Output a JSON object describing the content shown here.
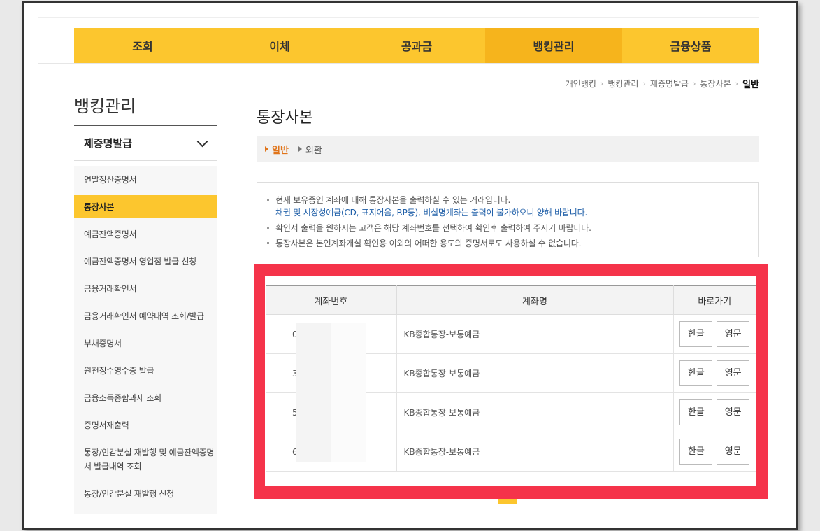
{
  "gnb": [
    "조회",
    "이체",
    "공과금",
    "뱅킹관리",
    "금융상품"
  ],
  "breadcrumb": [
    "개인뱅킹",
    "뱅킹관리",
    "제증명발급",
    "통장사본",
    "일반"
  ],
  "sidebar": {
    "title": "뱅킹관리",
    "group": "제증명발급",
    "items": [
      "연말정산증명서",
      "통장사본",
      "예금잔액증명서",
      "예금잔액증명서 영업점 발급 신청",
      "금융거래확인서",
      "금융거래확인서 예약내역 조회/발급",
      "부채증명서",
      "원천징수영수증 발급",
      "금융소득종합과세 조회",
      "증명서재출력",
      "통장/인감분실 재발행 및 예금잔액증명서 발급내역 조회",
      "통장/인감분실 재발행 신청"
    ]
  },
  "main": {
    "title": "통장사본",
    "tabs": [
      "일반",
      "외환"
    ],
    "notices": [
      "현재 보유중인 계좌에 대해 통장사본을 출력하실 수 있는 거래입니다.",
      "채권 및 시장성예금(CD, 표지어음, RP등), 비실명계좌는 출력이 불가하오니 양해 바랍니다.",
      "확인서 출력을 원하시는 고객은 해당 계좌번호를 선택하여 확인후 출력하여 주시기 바랍니다.",
      "통장사본은 본인계좌개설 확인용 이외의 어떠한 용도의 증명서로도 사용하실 수 없습니다."
    ]
  },
  "table": {
    "headers": [
      "계좌번호",
      "계좌명",
      "바로가기"
    ],
    "rows": [
      {
        "acct": "0",
        "name": "KB종합통장-보통예금"
      },
      {
        "acct": "3",
        "name": "KB종합통장-보통예금"
      },
      {
        "acct": "5",
        "name": "KB종합통장-보통예금"
      },
      {
        "acct": "6",
        "name": "KB종합통장-보통예금"
      }
    ],
    "btn_kor": "한글",
    "btn_eng": "영문"
  }
}
